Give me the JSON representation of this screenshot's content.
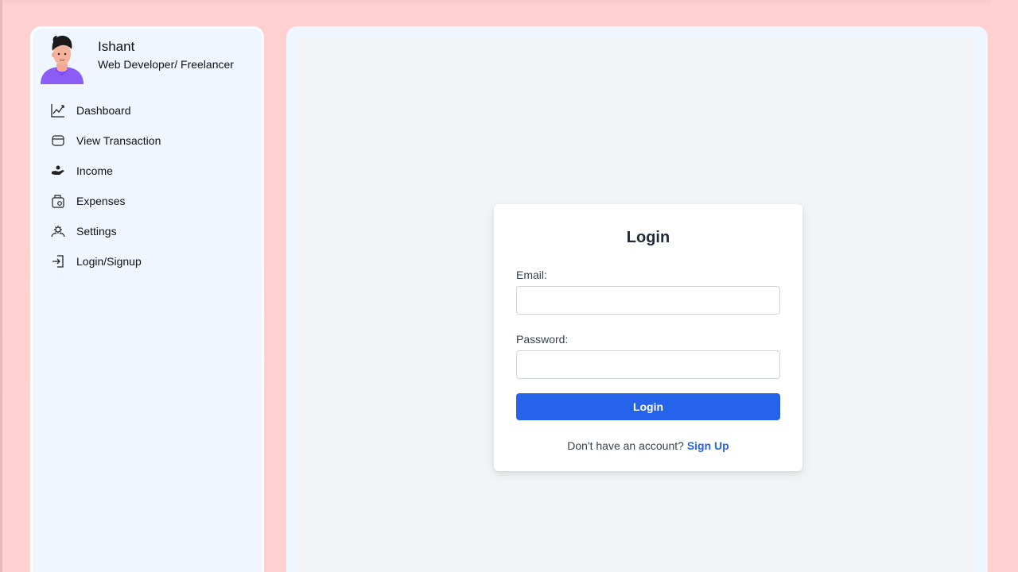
{
  "profile": {
    "name": "Ishant",
    "role": "Web Developer/ Freelancer",
    "avatar_icon": "person-avatar"
  },
  "sidebar": {
    "items": [
      {
        "label": "Dashboard",
        "icon": "chart-line-icon"
      },
      {
        "label": "View Transaction",
        "icon": "card-icon"
      },
      {
        "label": "Income",
        "icon": "hand-money-icon"
      },
      {
        "label": "Expenses",
        "icon": "wallet-icon"
      },
      {
        "label": "Settings",
        "icon": "gear-group-icon"
      },
      {
        "label": "Login/Signup",
        "icon": "login-icon"
      }
    ]
  },
  "login_form": {
    "title": "Login",
    "email_label": "Email:",
    "email_value": "",
    "password_label": "Password:",
    "password_value": "",
    "submit_label": "Login",
    "signup_prompt": "Don't have an account?",
    "signup_link": "Sign Up"
  },
  "colors": {
    "background": "#ffd1d0",
    "panel": "#eff6ff",
    "primary": "#2563eb",
    "avatar_shirt": "#8b5cf6"
  }
}
